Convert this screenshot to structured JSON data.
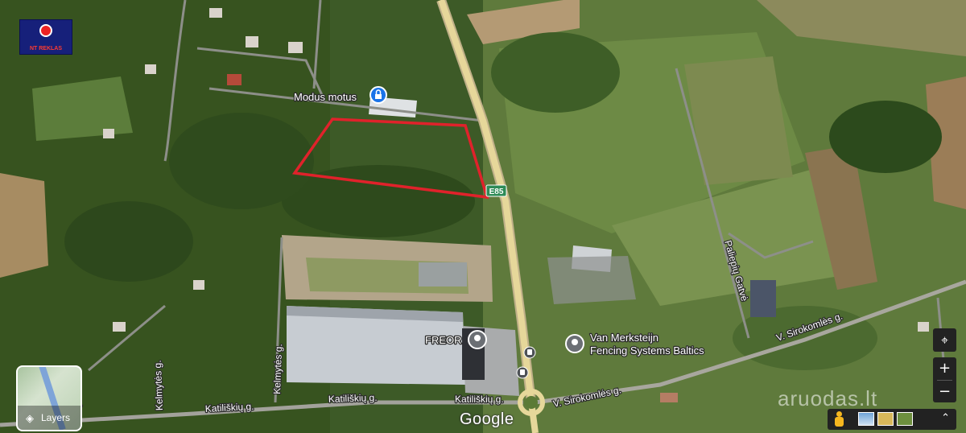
{
  "logo": {
    "text": "NT REKLAS"
  },
  "places": [
    {
      "id": "modus",
      "name": "Modus motus",
      "icon": "lock-pin-icon"
    },
    {
      "id": "freor",
      "name": "FREOR",
      "icon": "place-pin-icon"
    },
    {
      "id": "van",
      "name_line1": "Van Merksteijn",
      "name_line2": "Fencing Systems Baltics",
      "icon": "place-pin-icon"
    }
  ],
  "roads": {
    "highway_shield": "E85",
    "katiliskiu_1": "Katiliškių g.",
    "katiliskiu_2": "Katiliškių g.",
    "katiliskiu_3": "Katiliškių g.",
    "kelmytes_1": "Kelmytės g.",
    "kelmytes_2": "Kelmytės g.",
    "paliepiu": "Paliepių Gatvė",
    "sirokomles_1": "V. Sirokomlės g.",
    "sirokomles_2": "V. Sirokomlės g."
  },
  "controls": {
    "layers_label": "Layers",
    "zoom_in": "+",
    "zoom_out": "−",
    "locate_icon": "crosshair-icon"
  },
  "brand": "Google",
  "watermark": "aruodas.lt",
  "colors": {
    "parcel_outline": "#e0222b",
    "highway": "#e6d79a",
    "poi_pin": "#1a73e8"
  }
}
